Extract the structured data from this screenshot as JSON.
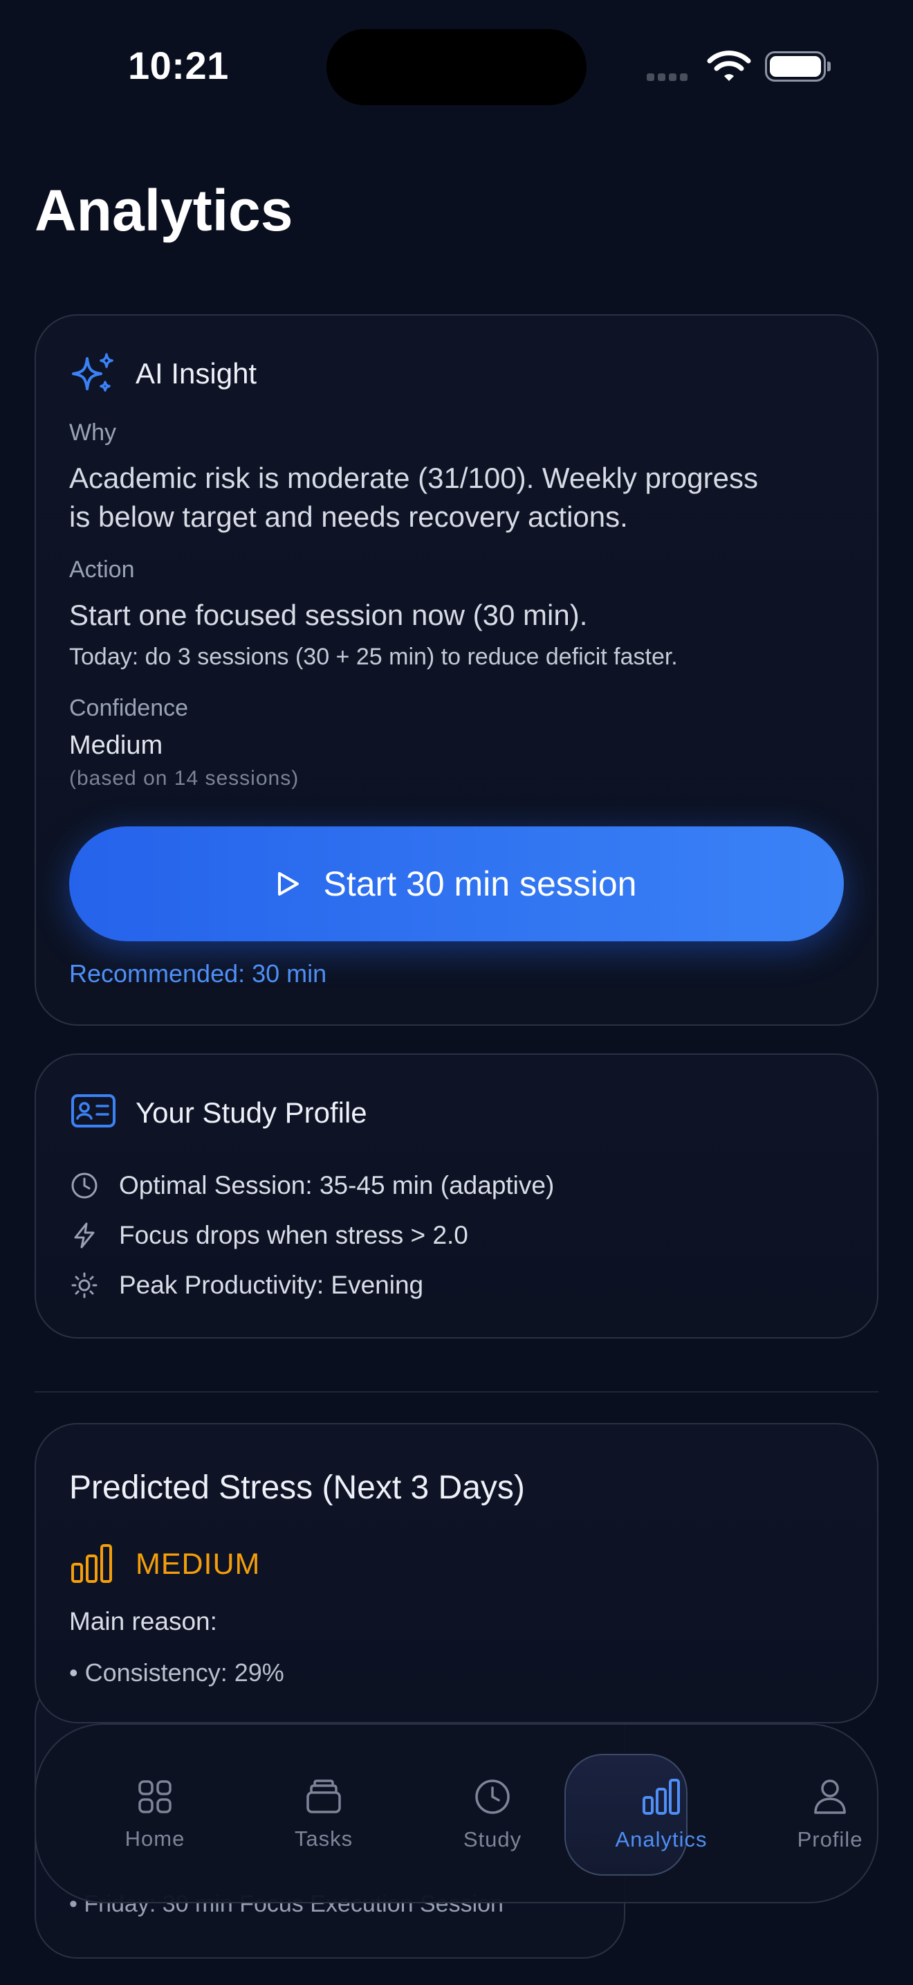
{
  "status_bar": {
    "time": "10:21"
  },
  "page": {
    "title": "Analytics"
  },
  "ai_insight": {
    "title": "AI Insight",
    "why_label": "Why",
    "why_line1": "Academic risk is moderate (31/100). Weekly progress",
    "why_line2": "is below target and needs recovery actions.",
    "action_label": "Action",
    "action_text": "Start one focused session now (30 min).",
    "action_detail": "Today: do 3 sessions (30 + 25 min) to reduce deficit faster.",
    "confidence_label": "Confidence",
    "confidence_value": "Medium",
    "confidence_note": "(based on 14 sessions)",
    "cta_label": "Start 30 min session",
    "recommended": "Recommended: 30 min"
  },
  "study_profile": {
    "title": "Your Study Profile",
    "items": [
      {
        "icon": "clock-icon",
        "text": "Optimal Session: 35-45 min (adaptive)"
      },
      {
        "icon": "lightning-icon",
        "text": "Focus drops when stress > 2.0"
      },
      {
        "icon": "sun-icon",
        "text": "Peak Productivity: Evening"
      }
    ]
  },
  "predicted_stress": {
    "title": "Predicted Stress (Next 3 Days)",
    "level": "MEDIUM",
    "reason_label": "Main reason:",
    "reason": "• Consistency: 29%"
  },
  "partial_card": {
    "text": "• Friday: 30 min Focus Execution Session"
  },
  "colors": {
    "accent": "#3b82f6",
    "warning": "#f59e0b",
    "background": "#0a0f1f"
  },
  "tabbar": {
    "tabs": [
      {
        "label": "Home",
        "icon": "grid-icon"
      },
      {
        "label": "Tasks",
        "icon": "stack-icon"
      },
      {
        "label": "Study",
        "icon": "clock-icon"
      },
      {
        "label": "Analytics",
        "icon": "bar-chart-icon",
        "active": true
      },
      {
        "label": "Profile",
        "icon": "person-icon"
      }
    ]
  }
}
